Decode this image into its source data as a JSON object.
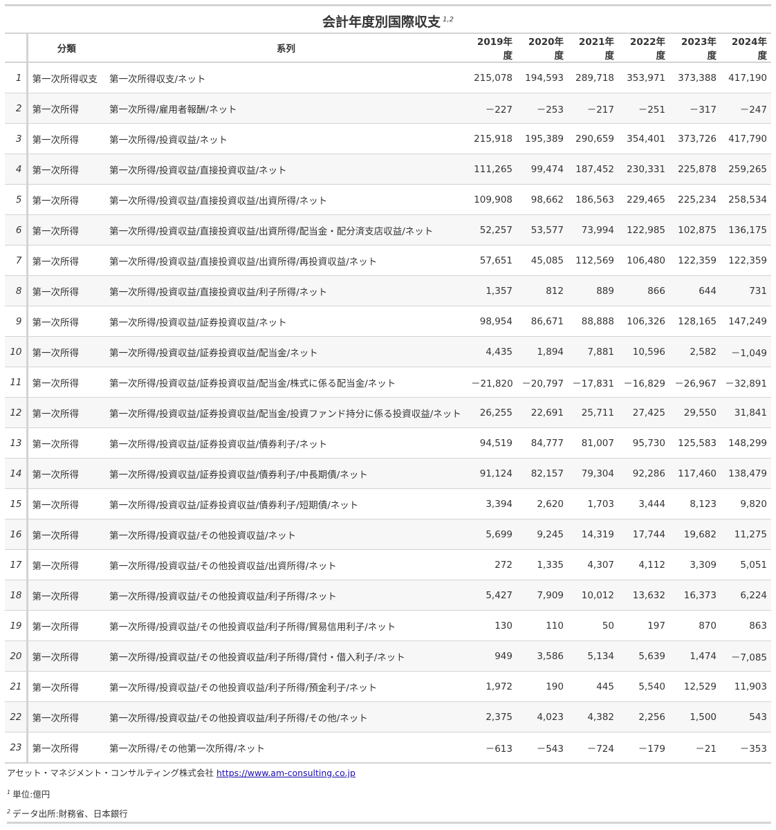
{
  "title": "会計年度別国際収支",
  "title_note_marks": "1,2",
  "headers": {
    "rownum": "",
    "category": "分類",
    "series": "系列",
    "years": [
      "2019年度",
      "2020年度",
      "2021年度",
      "2022年度",
      "2023年度",
      "2024年度"
    ]
  },
  "rows": [
    {
      "n": "1",
      "category": "第一次所得収支",
      "series": "第一次所得収支/ネット",
      "values": [
        "215,078",
        "194,593",
        "289,718",
        "353,971",
        "373,388",
        "417,190"
      ]
    },
    {
      "n": "2",
      "category": "第一次所得",
      "series": "第一次所得/雇用者報酬/ネット",
      "values": [
        "－227",
        "－253",
        "－217",
        "－251",
        "－317",
        "－247"
      ]
    },
    {
      "n": "3",
      "category": "第一次所得",
      "series": "第一次所得/投資収益/ネット",
      "values": [
        "215,918",
        "195,389",
        "290,659",
        "354,401",
        "373,726",
        "417,790"
      ]
    },
    {
      "n": "4",
      "category": "第一次所得",
      "series": "第一次所得/投資収益/直接投資収益/ネット",
      "values": [
        "111,265",
        "99,474",
        "187,452",
        "230,331",
        "225,878",
        "259,265"
      ]
    },
    {
      "n": "5",
      "category": "第一次所得",
      "series": "第一次所得/投資収益/直接投資収益/出資所得/ネット",
      "values": [
        "109,908",
        "98,662",
        "186,563",
        "229,465",
        "225,234",
        "258,534"
      ]
    },
    {
      "n": "6",
      "category": "第一次所得",
      "series": "第一次所得/投資収益/直接投資収益/出資所得/配当金・配分済支店収益/ネット",
      "values": [
        "52,257",
        "53,577",
        "73,994",
        "122,985",
        "102,875",
        "136,175"
      ]
    },
    {
      "n": "7",
      "category": "第一次所得",
      "series": "第一次所得/投資収益/直接投資収益/出資所得/再投資収益/ネット",
      "values": [
        "57,651",
        "45,085",
        "112,569",
        "106,480",
        "122,359",
        "122,359"
      ]
    },
    {
      "n": "8",
      "category": "第一次所得",
      "series": "第一次所得/投資収益/直接投資収益/利子所得/ネット",
      "values": [
        "1,357",
        "812",
        "889",
        "866",
        "644",
        "731"
      ]
    },
    {
      "n": "9",
      "category": "第一次所得",
      "series": "第一次所得/投資収益/証券投資収益/ネット",
      "values": [
        "98,954",
        "86,671",
        "88,888",
        "106,326",
        "128,165",
        "147,249"
      ]
    },
    {
      "n": "10",
      "category": "第一次所得",
      "series": "第一次所得/投資収益/証券投資収益/配当金/ネット",
      "values": [
        "4,435",
        "1,894",
        "7,881",
        "10,596",
        "2,582",
        "－1,049"
      ]
    },
    {
      "n": "11",
      "category": "第一次所得",
      "series": "第一次所得/投資収益/証券投資収益/配当金/株式に係る配当金/ネット",
      "values": [
        "－21,820",
        "－20,797",
        "－17,831",
        "－16,829",
        "－26,967",
        "－32,891"
      ]
    },
    {
      "n": "12",
      "category": "第一次所得",
      "series": "第一次所得/投資収益/証券投資収益/配当金/投資ファンド持分に係る投資収益/ネット",
      "values": [
        "26,255",
        "22,691",
        "25,711",
        "27,425",
        "29,550",
        "31,841"
      ]
    },
    {
      "n": "13",
      "category": "第一次所得",
      "series": "第一次所得/投資収益/証券投資収益/債券利子/ネット",
      "values": [
        "94,519",
        "84,777",
        "81,007",
        "95,730",
        "125,583",
        "148,299"
      ]
    },
    {
      "n": "14",
      "category": "第一次所得",
      "series": "第一次所得/投資収益/証券投資収益/債券利子/中長期債/ネット",
      "values": [
        "91,124",
        "82,157",
        "79,304",
        "92,286",
        "117,460",
        "138,479"
      ]
    },
    {
      "n": "15",
      "category": "第一次所得",
      "series": "第一次所得/投資収益/証券投資収益/債券利子/短期債/ネット",
      "values": [
        "3,394",
        "2,620",
        "1,703",
        "3,444",
        "8,123",
        "9,820"
      ]
    },
    {
      "n": "16",
      "category": "第一次所得",
      "series": "第一次所得/投資収益/その他投資収益/ネット",
      "values": [
        "5,699",
        "9,245",
        "14,319",
        "17,744",
        "19,682",
        "11,275"
      ]
    },
    {
      "n": "17",
      "category": "第一次所得",
      "series": "第一次所得/投資収益/その他投資収益/出資所得/ネット",
      "values": [
        "272",
        "1,335",
        "4,307",
        "4,112",
        "3,309",
        "5,051"
      ]
    },
    {
      "n": "18",
      "category": "第一次所得",
      "series": "第一次所得/投資収益/その他投資収益/利子所得/ネット",
      "values": [
        "5,427",
        "7,909",
        "10,012",
        "13,632",
        "16,373",
        "6,224"
      ]
    },
    {
      "n": "19",
      "category": "第一次所得",
      "series": "第一次所得/投資収益/その他投資収益/利子所得/貿易信用利子/ネット",
      "values": [
        "130",
        "110",
        "50",
        "197",
        "870",
        "863"
      ]
    },
    {
      "n": "20",
      "category": "第一次所得",
      "series": "第一次所得/投資収益/その他投資収益/利子所得/貸付・借入利子/ネット",
      "values": [
        "949",
        "3,586",
        "5,134",
        "5,639",
        "1,474",
        "－7,085"
      ]
    },
    {
      "n": "21",
      "category": "第一次所得",
      "series": "第一次所得/投資収益/その他投資収益/利子所得/預金利子/ネット",
      "values": [
        "1,972",
        "190",
        "445",
        "5,540",
        "12,529",
        "11,903"
      ]
    },
    {
      "n": "22",
      "category": "第一次所得",
      "series": "第一次所得/投資収益/その他投資収益/利子所得/その他/ネット",
      "values": [
        "2,375",
        "4,023",
        "4,382",
        "2,256",
        "1,500",
        "543"
      ]
    },
    {
      "n": "23",
      "category": "第一次所得",
      "series": "第一次所得/その他第一次所得/ネット",
      "values": [
        "－613",
        "－543",
        "－724",
        "－179",
        "－21",
        "－353"
      ]
    }
  ],
  "footer": {
    "source_company": "アセット・マネジメント・コンサルティング株式会社",
    "source_url": "https://www.am-consulting.co.jp",
    "note1_mark": "1",
    "note1": "単位:億円",
    "note2_mark": "2",
    "note2": "データ出所:財務省、日本銀行"
  }
}
